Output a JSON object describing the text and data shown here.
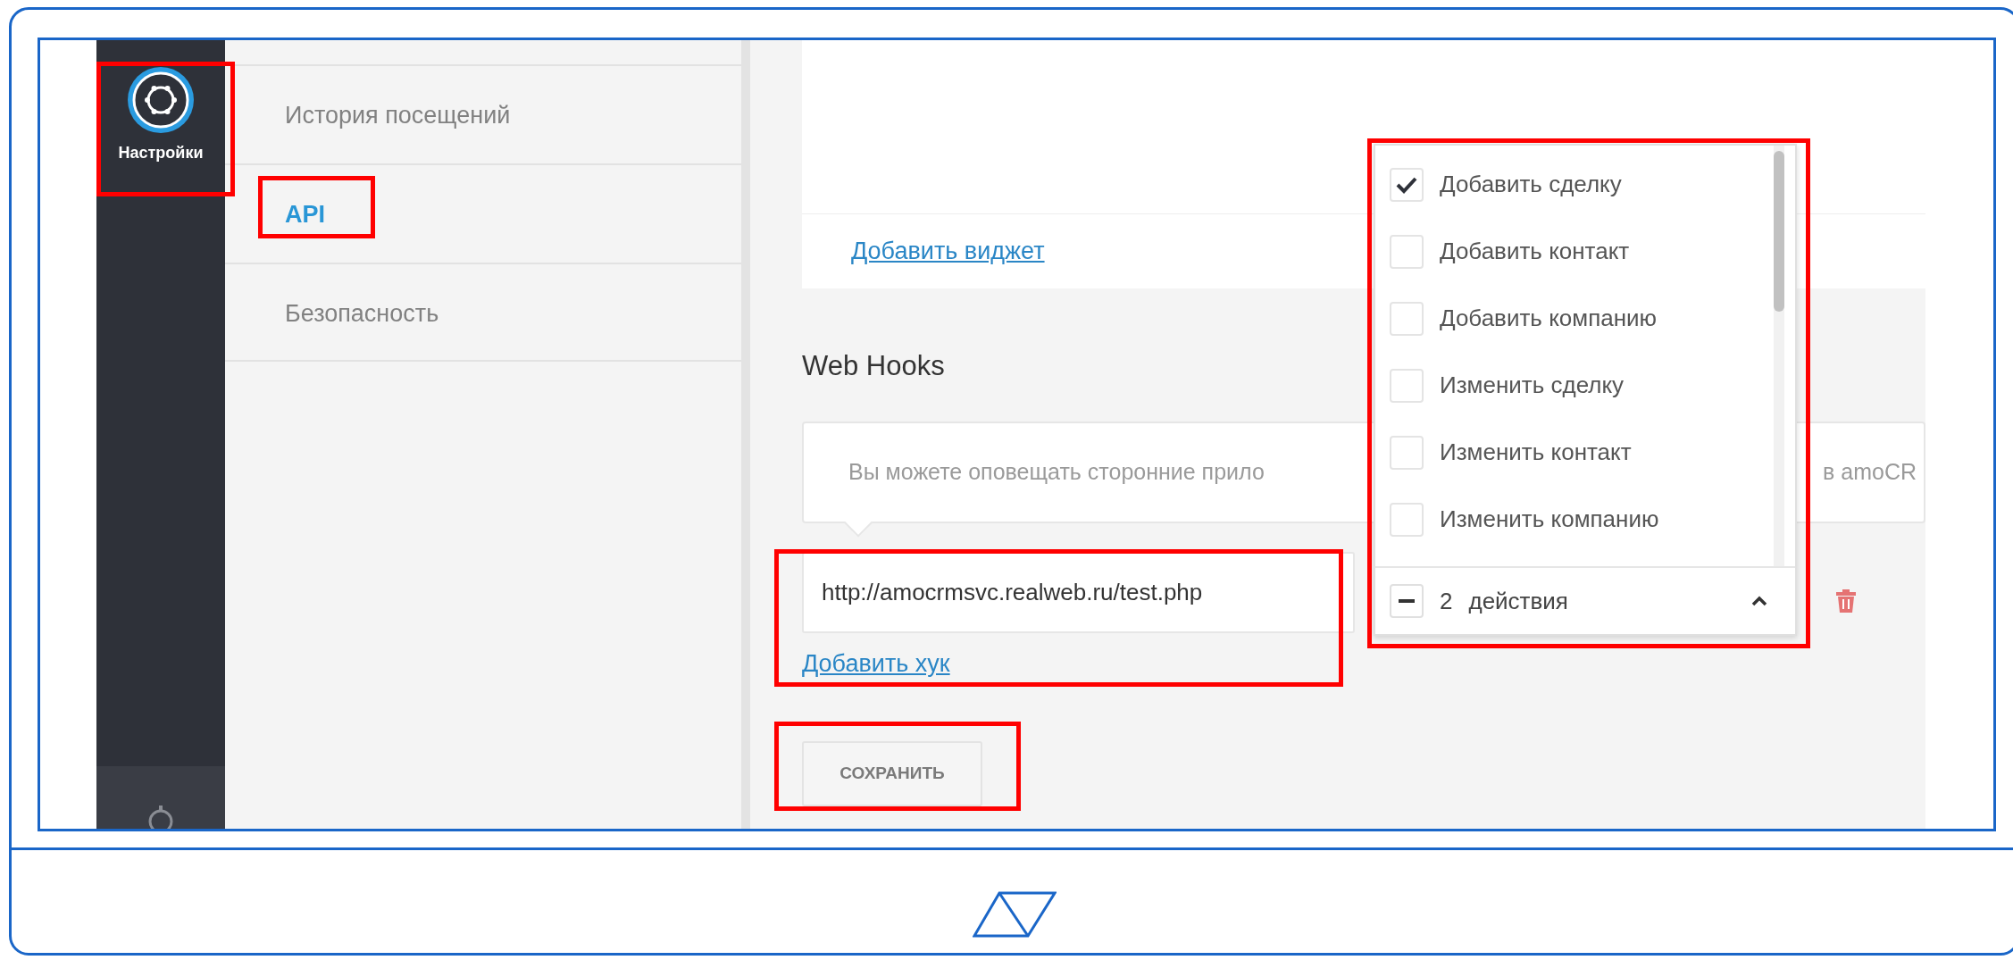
{
  "sidebar": {
    "items": [
      {
        "kind": "settings",
        "label": "Настройки",
        "selected": true
      },
      {
        "kind": "stopwatch",
        "selected": false
      }
    ]
  },
  "settings_menu": {
    "items": [
      {
        "label": "История посещений",
        "selected": false
      },
      {
        "label": "API",
        "selected": true
      },
      {
        "label": "Безопасность",
        "selected": false
      }
    ]
  },
  "widgets": {
    "add_link": "Добавить виджет"
  },
  "webhooks": {
    "title": "Web Hooks",
    "info_text_left": "Вы можете оповещать сторонние прило",
    "info_text_right": "в amoCR",
    "hooks": [
      {
        "url": "http://amocrmsvc.realweb.ru/test.php",
        "actions_count": "2",
        "actions_label": "действия",
        "expanded": true,
        "actions": [
          {
            "label": "Добавить сделку",
            "checked": true
          },
          {
            "label": "Добавить контакт",
            "checked": false
          },
          {
            "label": "Добавить компанию",
            "checked": false
          },
          {
            "label": "Изменить сделку",
            "checked": false
          },
          {
            "label": "Изменить контакт",
            "checked": false
          },
          {
            "label": "Изменить компанию",
            "checked": false
          }
        ]
      }
    ],
    "add_link": "Добавить хук",
    "save_button": "СОХРАНИТЬ"
  }
}
